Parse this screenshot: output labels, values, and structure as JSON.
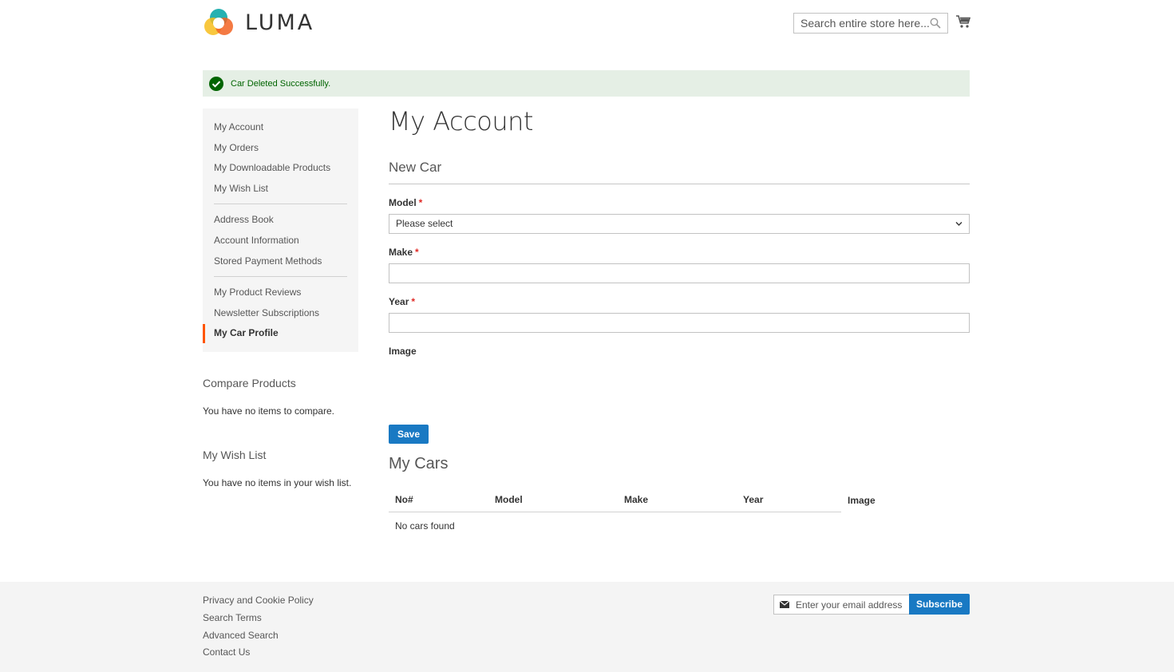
{
  "header": {
    "brand": "LUMA",
    "search_placeholder": "Search entire store here...",
    "icons": [
      "luma-logo-icon",
      "search-icon",
      "cart-icon"
    ]
  },
  "message": {
    "text": "Car Deleted Successfully.",
    "icon": "check-circle-icon",
    "color": "#006400",
    "background": "#e5efe5"
  },
  "sidebar": {
    "groups": [
      [
        "My Account",
        "My Orders",
        "My Downloadable Products",
        "My Wish List"
      ],
      [
        "Address Book",
        "Account Information",
        "Stored Payment Methods"
      ],
      [
        "My Product Reviews",
        "Newsletter Subscriptions",
        "My Car Profile"
      ]
    ],
    "active": "My Car Profile",
    "active_color": "#ff5501",
    "compare_title": "Compare Products",
    "compare_text": "You have no items to compare.",
    "wishlist_title": "My Wish List",
    "wishlist_text": "You have no items in your wish list."
  },
  "main": {
    "page_title": "My Account",
    "form_title": "New Car",
    "fields": {
      "model_label": "Model",
      "model_value": "Please select",
      "make_label": "Make",
      "make_value": "",
      "year_label": "Year",
      "year_value": "",
      "image_label": "Image"
    },
    "required_mark": "*",
    "save_label": "Save",
    "cars_title": "My Cars",
    "table": {
      "columns": [
        "No#",
        "Model",
        "Make",
        "Year",
        "Image"
      ],
      "empty_text": "No cars found"
    },
    "accent": "#1979c3"
  },
  "footer": {
    "links": [
      "Privacy and Cookie Policy",
      "Search Terms",
      "Advanced Search",
      "Contact Us"
    ],
    "newsletter_placeholder": "Enter your email address",
    "subscribe_label": "Subscribe"
  }
}
